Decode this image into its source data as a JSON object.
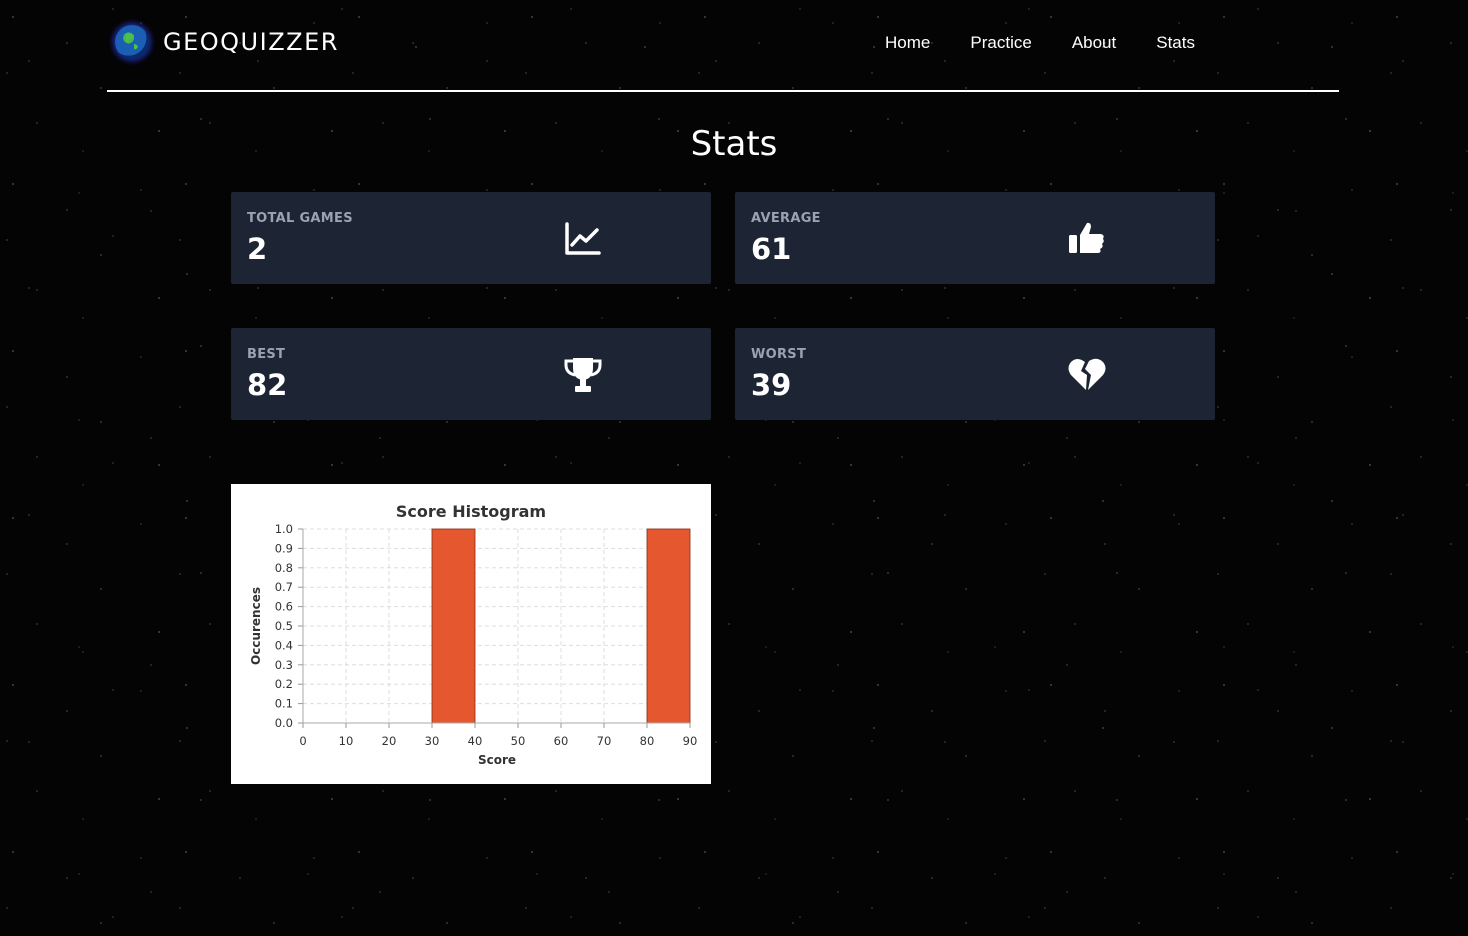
{
  "app": {
    "brand": "GEOQUIZZER",
    "logo_icon": "globe-icon"
  },
  "nav": {
    "items": [
      {
        "label": "Home"
      },
      {
        "label": "Practice"
      },
      {
        "label": "About"
      },
      {
        "label": "Stats"
      }
    ]
  },
  "page": {
    "title": "Stats"
  },
  "cards": {
    "total_games": {
      "label": "TOTAL GAMES",
      "value": "2",
      "icon": "line-chart-icon"
    },
    "average": {
      "label": "AVERAGE",
      "value": "61",
      "icon": "thumbs-up-icon"
    },
    "best": {
      "label": "BEST",
      "value": "82",
      "icon": "trophy-icon"
    },
    "worst": {
      "label": "WORST",
      "value": "39",
      "icon": "broken-heart-icon"
    }
  },
  "colors": {
    "card_bg": "#1d2433",
    "bar": "#e5582f",
    "label_gray": "#9aa3b2"
  },
  "chart_data": {
    "type": "bar",
    "title": "Score Histogram",
    "xlabel": "Score",
    "ylabel": "Occurences",
    "xlim": [
      0,
      90
    ],
    "ylim": [
      0,
      1
    ],
    "x_ticks": [
      0,
      10,
      20,
      30,
      40,
      50,
      60,
      70,
      80,
      90
    ],
    "y_ticks": [
      "0.0",
      "0.1",
      "0.2",
      "0.3",
      "0.4",
      "0.5",
      "0.6",
      "0.7",
      "0.8",
      "0.9",
      "1.0"
    ],
    "bins": [
      {
        "start": 30,
        "end": 40,
        "count": 1
      },
      {
        "start": 80,
        "end": 90,
        "count": 1
      }
    ],
    "grid": true,
    "legend": "none"
  }
}
